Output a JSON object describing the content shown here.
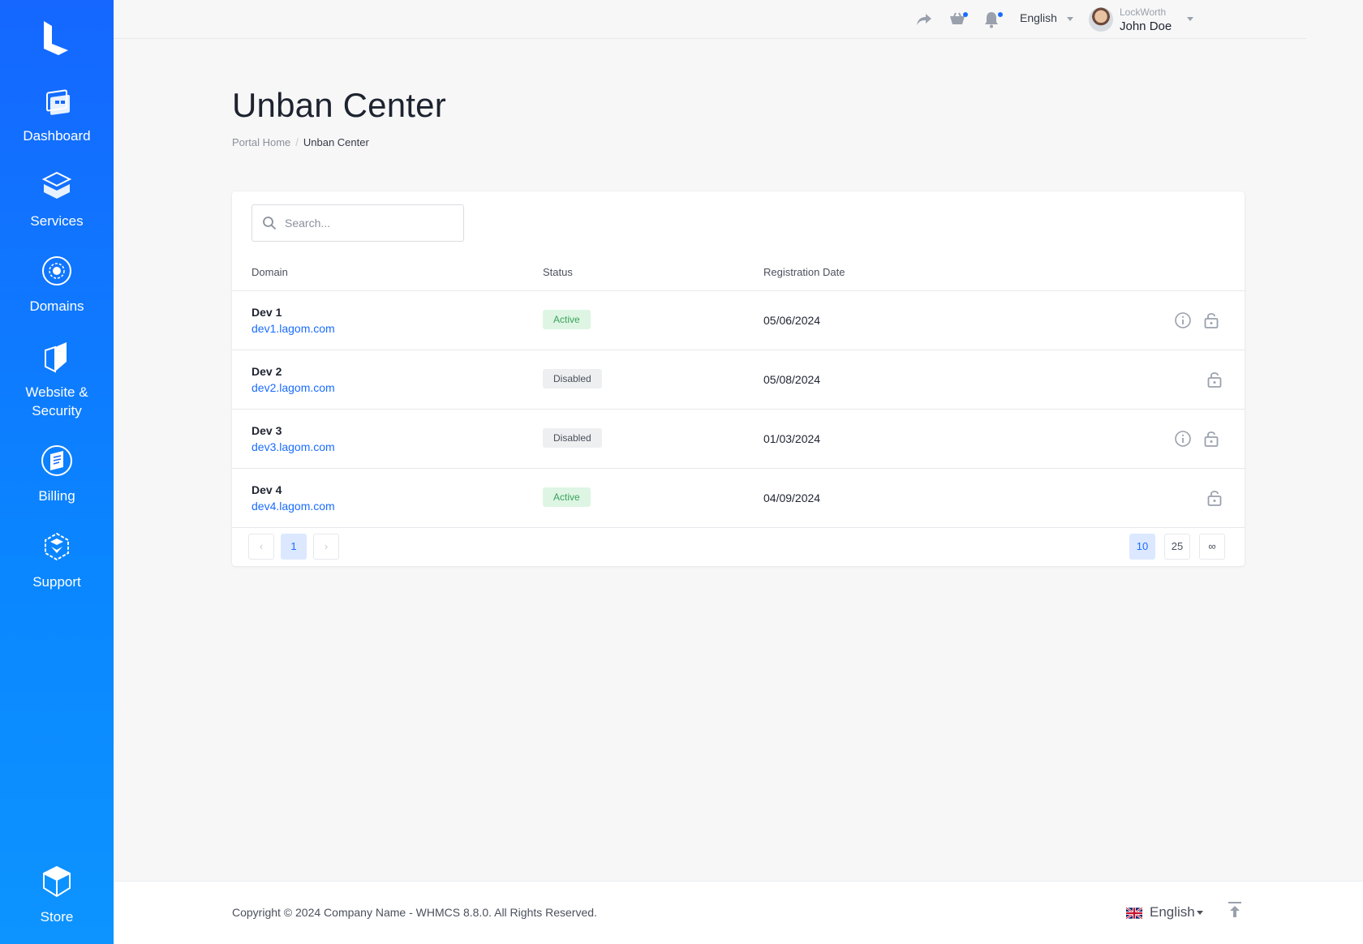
{
  "sidebar": {
    "items": [
      {
        "label": "Dashboard",
        "icon": "dashboard-icon"
      },
      {
        "label": "Services",
        "icon": "services-icon"
      },
      {
        "label": "Domains",
        "icon": "domains-icon"
      },
      {
        "label": "Website &\nSecurity",
        "label_line1": "Website &",
        "label_line2": "Security",
        "icon": "website-security-icon"
      },
      {
        "label": "Billing",
        "icon": "billing-icon"
      },
      {
        "label": "Support",
        "icon": "support-icon"
      },
      {
        "label": "Store",
        "icon": "store-icon"
      }
    ]
  },
  "topbar": {
    "language": "English",
    "company": "LockWorth",
    "user_name": "John Doe"
  },
  "page": {
    "title": "Unban Center",
    "breadcrumb_home": "Portal Home",
    "breadcrumb_current": "Unban Center"
  },
  "table": {
    "search_placeholder": "Search...",
    "columns": [
      "Domain",
      "Status",
      "Registration Date"
    ],
    "rows": [
      {
        "name": "Dev 1",
        "domain": "dev1.lagom.com",
        "status": "Active",
        "date": "05/06/2024",
        "has_info": true
      },
      {
        "name": "Dev 2",
        "domain": "dev2.lagom.com",
        "status": "Disabled",
        "date": "05/08/2024",
        "has_info": false
      },
      {
        "name": "Dev 3",
        "domain": "dev3.lagom.com",
        "status": "Disabled",
        "date": "01/03/2024",
        "has_info": true
      },
      {
        "name": "Dev 4",
        "domain": "dev4.lagom.com",
        "status": "Active",
        "date": "04/09/2024",
        "has_info": false
      }
    ],
    "pagination": {
      "prev": "‹",
      "current_page": "1",
      "next": "›"
    },
    "page_sizes": [
      "10",
      "25",
      "∞"
    ],
    "selected_page_size": "10"
  },
  "footer": {
    "copyright": "Copyright © 2024 Company Name - WHMCS 8.8.0. All Rights Reserved.",
    "language": "English"
  },
  "colors": {
    "sidebar_top": "#1567ff",
    "sidebar_bottom": "#0d94ff",
    "accent": "#1a6cff",
    "active_badge_bg": "#def5e4",
    "active_badge_text": "#3aa25c",
    "disabled_badge_bg": "#eeeff1"
  }
}
